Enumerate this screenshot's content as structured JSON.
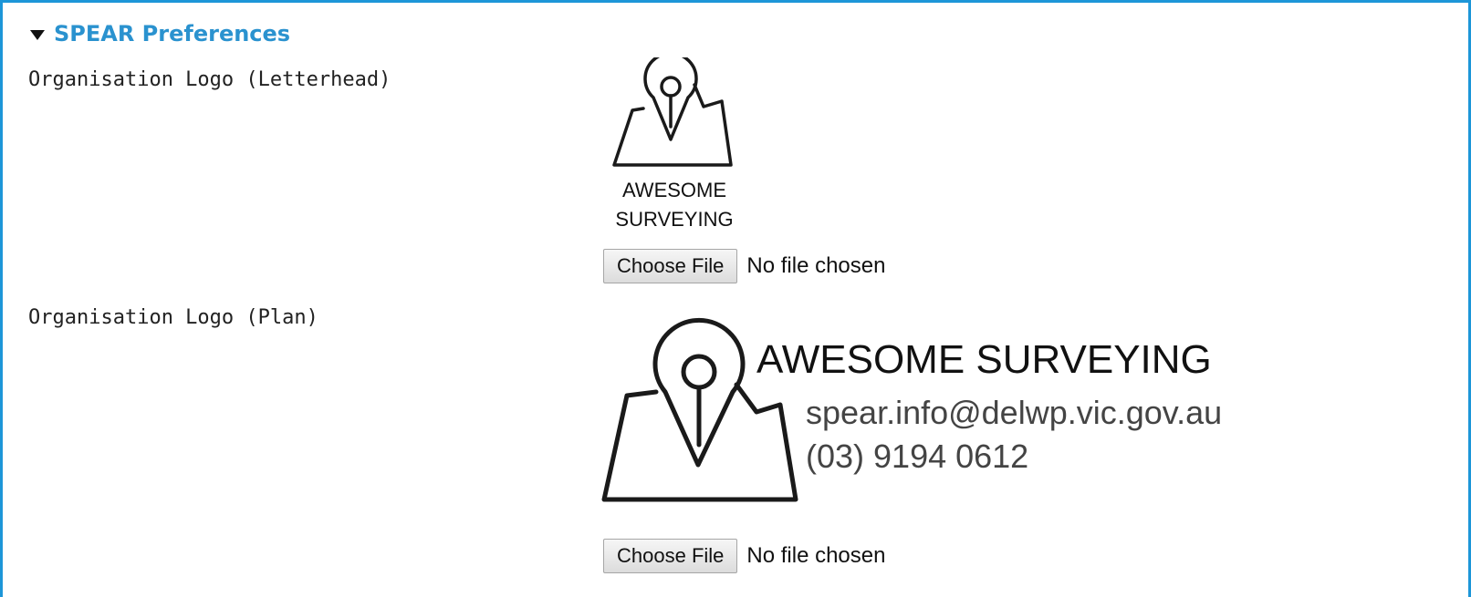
{
  "section": {
    "title": "SPEAR Preferences",
    "icon": "triangle-down-icon",
    "accent_color": "#1d96d8"
  },
  "fields": {
    "letterhead": {
      "label": "Organisation Logo (Letterhead)",
      "logo_line1": "AWESOME",
      "logo_line2": "SURVEYING",
      "choose_label": "Choose File",
      "status": "No file chosen"
    },
    "plan": {
      "label": "Organisation Logo (Plan)",
      "logo_title": "AWESOME SURVEYING",
      "logo_email": "spear.info@delwp.vic.gov.au",
      "logo_phone": "(03) 9194 0612",
      "choose_label": "Choose File",
      "status": "No file chosen"
    }
  }
}
